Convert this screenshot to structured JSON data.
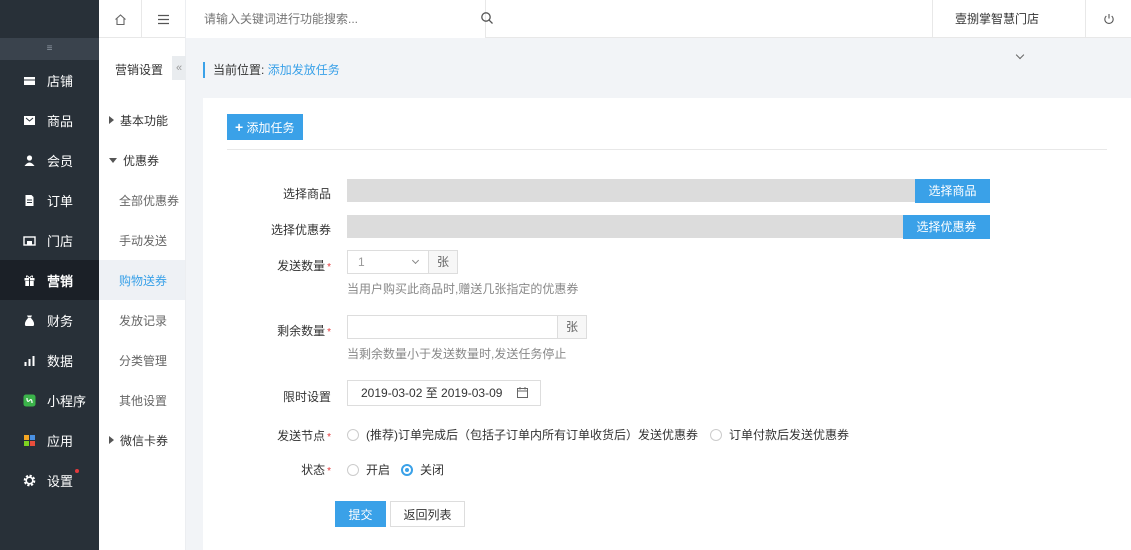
{
  "nav": {
    "items": [
      {
        "label": "店铺",
        "icon": "store-icon"
      },
      {
        "label": "商品",
        "icon": "goods-icon"
      },
      {
        "label": "会员",
        "icon": "member-icon"
      },
      {
        "label": "订单",
        "icon": "order-icon"
      },
      {
        "label": "门店",
        "icon": "shop-icon"
      },
      {
        "label": "营销",
        "icon": "gift-icon"
      },
      {
        "label": "财务",
        "icon": "money-bag-icon"
      },
      {
        "label": "数据",
        "icon": "bar-chart-icon"
      },
      {
        "label": "小程序",
        "icon": "miniapp-icon"
      },
      {
        "label": "应用",
        "icon": "apps-icon"
      },
      {
        "label": "设置",
        "icon": "gear-icon"
      }
    ],
    "active_index": 5
  },
  "subnav": {
    "title": "营销设置",
    "items": [
      {
        "label": "基本功能",
        "type": "group-collapsed"
      },
      {
        "label": "优惠券",
        "type": "group-expanded"
      },
      {
        "label": "全部优惠券",
        "type": "item"
      },
      {
        "label": "手动发送",
        "type": "item"
      },
      {
        "label": "购物送券",
        "type": "item-active"
      },
      {
        "label": "发放记录",
        "type": "item"
      },
      {
        "label": "分类管理",
        "type": "item"
      },
      {
        "label": "其他设置",
        "type": "item"
      },
      {
        "label": "微信卡券",
        "type": "group-collapsed"
      }
    ]
  },
  "header": {
    "search_placeholder": "请输入关键词进行功能搜索...",
    "store_name": "壹捌掌智慧门店"
  },
  "breadcrumb": {
    "prefix": "当前位置:",
    "current": "添加发放任务"
  },
  "form": {
    "add_task_label": "添加任务",
    "select_goods_label": "选择商品",
    "select_goods_button": "选择商品",
    "select_coupon_label": "选择优惠券",
    "select_coupon_button": "选择优惠券",
    "send_count_label": "发送数量",
    "send_count_value": "1",
    "send_count_unit": "张",
    "send_count_hint": "当用户购买此商品时,赠送几张指定的优惠券",
    "remain_count_label": "剩余数量",
    "remain_count_value": "",
    "remain_count_unit": "张",
    "remain_count_hint": "当剩余数量小于发送数量时,发送任务停止",
    "time_label": "限时设置",
    "time_value": "2019-03-02 至 2019-03-09",
    "node_label": "发送节点",
    "node_option_1": "(推荐)订单完成后（包括子订单内所有订单收货后）发送优惠券",
    "node_option_2": "订单付款后发送优惠券",
    "status_label": "状态",
    "status_on": "开启",
    "status_off": "关闭",
    "status_selected": "关闭",
    "submit_label": "提交",
    "back_label": "返回列表"
  },
  "colors": {
    "accent": "#3aa1e8",
    "nav_bg": "#283038",
    "required": "#e4393c"
  }
}
